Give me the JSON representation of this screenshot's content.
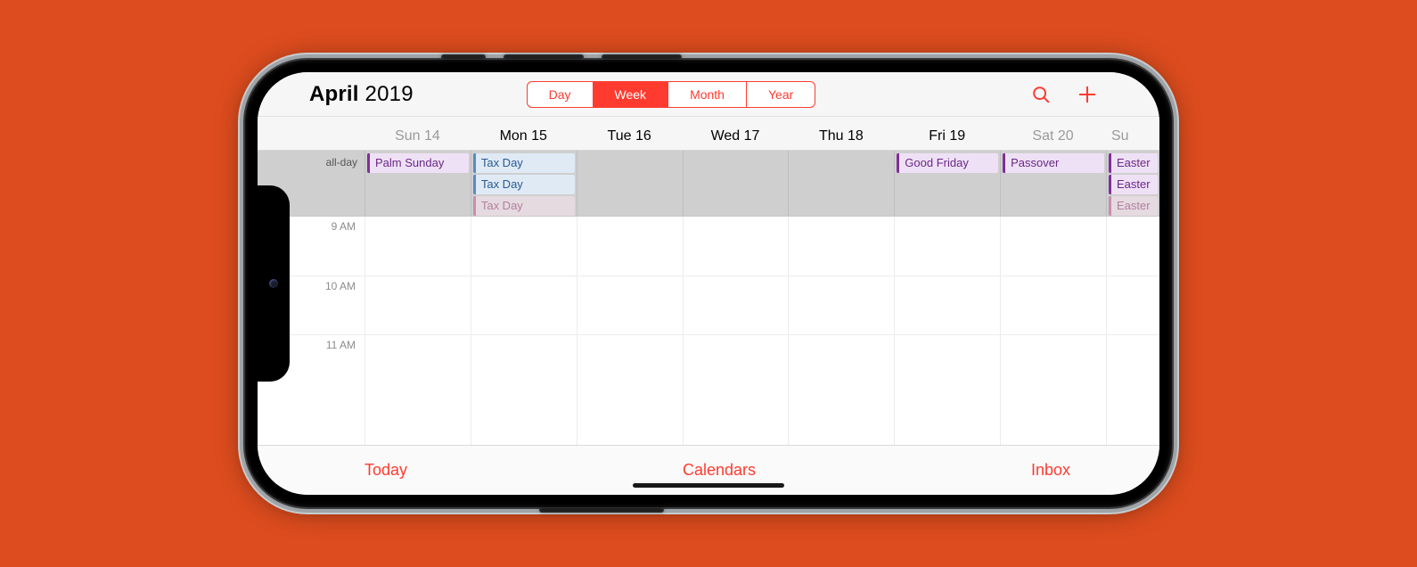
{
  "header": {
    "month": "April",
    "year": "2019",
    "segments": [
      "Day",
      "Week",
      "Month",
      "Year"
    ],
    "active_segment": "Week",
    "icons": {
      "search": "search-icon",
      "add": "plus-icon"
    }
  },
  "days": [
    {
      "label": "Sun 14",
      "muted": true
    },
    {
      "label": "Mon 15",
      "muted": false
    },
    {
      "label": "Tue 16",
      "muted": false
    },
    {
      "label": "Wed 17",
      "muted": false
    },
    {
      "label": "Thu 18",
      "muted": false
    },
    {
      "label": "Fri 19",
      "muted": false
    },
    {
      "label": "Sat 20",
      "muted": true
    },
    {
      "label": "Su",
      "muted": true
    }
  ],
  "allday": {
    "label": "all-day",
    "columns": [
      [
        {
          "title": "Palm Sunday",
          "style": "purple"
        }
      ],
      [
        {
          "title": "Tax Day",
          "style": "blue"
        },
        {
          "title": "Tax Day",
          "style": "blue"
        },
        {
          "title": "Tax Day",
          "style": "pink",
          "faded": true
        }
      ],
      [],
      [],
      [],
      [
        {
          "title": "Good Friday",
          "style": "purple"
        }
      ],
      [
        {
          "title": "Passover",
          "style": "purple"
        }
      ],
      [
        {
          "title": "Easter",
          "style": "purple"
        },
        {
          "title": "Easter",
          "style": "purple"
        },
        {
          "title": "Easter",
          "style": "pink",
          "faded": true
        }
      ]
    ]
  },
  "time_labels": [
    "9 AM",
    "10 AM",
    "11 AM"
  ],
  "toolbar": {
    "today": "Today",
    "calendars": "Calendars",
    "inbox": "Inbox"
  }
}
